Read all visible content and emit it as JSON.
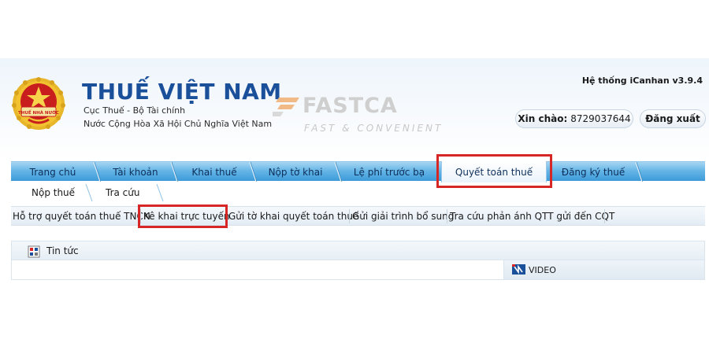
{
  "header": {
    "title": "THUẾ VIỆT NAM",
    "subtitle_line1": "Cục Thuế - Bộ Tài chính",
    "subtitle_line2": "Nước Cộng Hòa Xã Hội Chủ Nghĩa Việt Nam",
    "emblem_text": "THUẾ NHÀ NƯỚC",
    "system_version": "Hệ thống iCanhan v3.9.4"
  },
  "watermark": {
    "brand": "FASTCA",
    "tagline": "FAST & CONVENIENT"
  },
  "user": {
    "greeting_label": "Xin chào:",
    "user_id": "8729037644",
    "logout_label": "Đăng xuất"
  },
  "main_nav": {
    "items": [
      {
        "label": "Trang chủ"
      },
      {
        "label": "Tài khoản"
      },
      {
        "label": "Khai thuế"
      },
      {
        "label": "Nộp tờ khai"
      },
      {
        "label": "Lệ phí trước bạ"
      },
      {
        "label": "Quyết toán thuế"
      },
      {
        "label": "Đăng ký thuế"
      }
    ],
    "active_index": 5
  },
  "sub_nav": {
    "items": [
      {
        "label": "Nộp thuế"
      },
      {
        "label": "Tra cứu"
      }
    ]
  },
  "tool_bar": {
    "items": [
      {
        "label": "Hỗ trợ quyết toán thuế TNCN"
      },
      {
        "label": "Kê khai trực tuyến"
      },
      {
        "label": "Gửi tờ khai quyết toán thuế"
      },
      {
        "label": "Gửi giải trình bổ sung"
      },
      {
        "label": "Tra cứu phản ánh QTT gửi đến CQT"
      }
    ]
  },
  "news": {
    "title": "Tin tức"
  },
  "video": {
    "title": "VIDEO"
  },
  "colors": {
    "brand_blue": "#1a4f9a",
    "nav_blue": "#3e9bd8",
    "highlight_red": "#d62626",
    "emblem_red": "#c81e1e",
    "emblem_gold": "#f2c230"
  }
}
